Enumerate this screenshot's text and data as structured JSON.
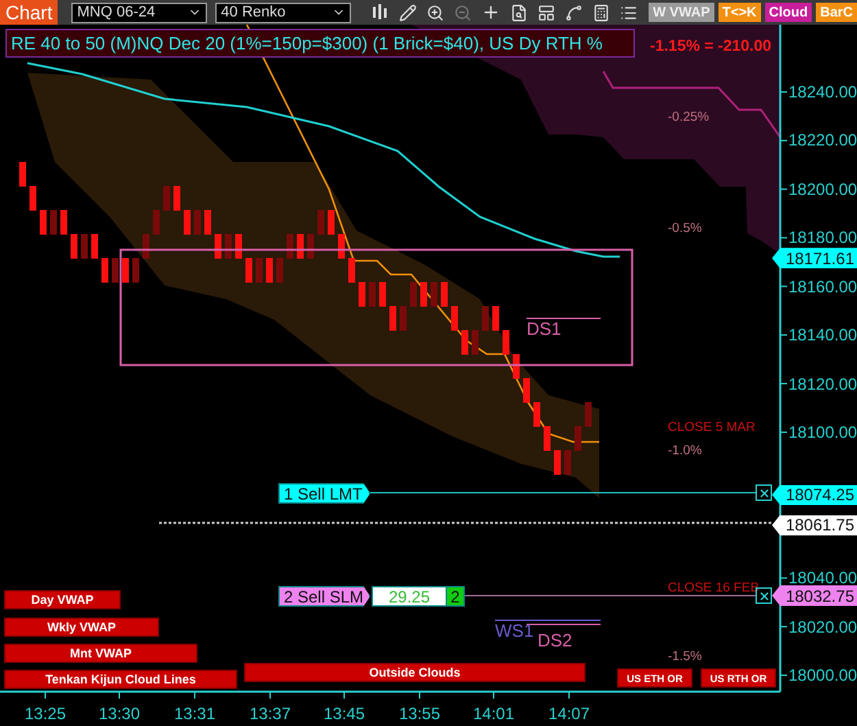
{
  "toolbar": {
    "title": "Chart",
    "instrument": "MNQ 06-24",
    "bar_type": "40 Renko",
    "buttons": [
      {
        "label": "W VWAP",
        "kind": "grey"
      },
      {
        "label": "T<>K",
        "kind": "orange"
      },
      {
        "label": "Cloud",
        "kind": "magenta"
      },
      {
        "label": "BarC",
        "kind": "orange"
      }
    ]
  },
  "header": {
    "label": "RE 40 to 50 (M)NQ Dec 20 (1%=150p=$300) (1 Brick=$40), US Dy RTH %",
    "change": "-1.15% = -210.00"
  },
  "price_axis": {
    "ticks": [
      "18240.00",
      "18220.00",
      "18200.00",
      "18180.00",
      "18160.00",
      "18140.00",
      "18120.00",
      "18100.00",
      "18040.00",
      "18020.00",
      "18000.00"
    ]
  },
  "price_tags": [
    {
      "text": "18171.61",
      "color": "#00ffff"
    },
    {
      "text": "18074.25",
      "color": "#00ffff"
    },
    {
      "text": "18061.75",
      "color": "#ffffff"
    },
    {
      "text": "18032.75",
      "color": "#ee82ee"
    }
  ],
  "time_axis": {
    "labels": [
      "13:25",
      "13:30",
      "13:31",
      "13:37",
      "13:45",
      "13:55",
      "14:01",
      "14:07"
    ]
  },
  "level_labels": [
    {
      "text": "-0.25%",
      "kind": "pct"
    },
    {
      "text": "-0.5%",
      "kind": "pct"
    },
    {
      "text": "CLOSE 5 MAR",
      "kind": "close"
    },
    {
      "text": "-1.0%",
      "kind": "pct"
    },
    {
      "text": "CLOSE 16 FEB",
      "kind": "close"
    },
    {
      "text": "-1.5%",
      "kind": "pct"
    }
  ],
  "zone_labels": [
    {
      "text": "DS1",
      "color": "#d85fa8"
    },
    {
      "text": "WS1",
      "color": "#6a5acd"
    },
    {
      "text": "DS2",
      "color": "#d85fa8"
    }
  ],
  "orders": [
    {
      "label": "1 Sell LMT",
      "color": "#00ffff"
    },
    {
      "label": "2 Sell SLM",
      "color": "#ee82ee",
      "price": "29.25",
      "quantity": "2"
    }
  ],
  "indicator_tags": [
    "Day VWAP",
    "Wkly VWAP",
    "Mnt VWAP",
    "Tenkan Kijun Cloud Lines",
    "Outside Clouds",
    "US ETH OR",
    "US RTH OR"
  ]
}
